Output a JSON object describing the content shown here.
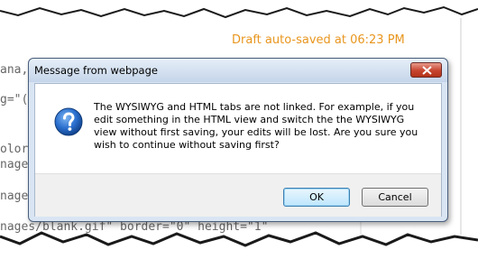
{
  "editor": {
    "autosave_text": "Draft auto-saved at 06:23 PM",
    "code_fragments": [
      "ana,",
      "g=\"(",
      "olor:",
      "nage",
      "nage",
      "nages/blank.gif\" border=\"0\" height=\"1\""
    ]
  },
  "dialog": {
    "title": "Message from webpage",
    "icon": "question-icon",
    "message": "The WYSIWYG and HTML tabs are not linked.  For example, if you edit something in the HTML view and switch the the WYSIWYG view without first saving, your edits will be lost.  Are you sure you wish to continue without saving first?",
    "ok_label": "OK",
    "cancel_label": "Cancel"
  },
  "colors": {
    "autosave": "#e8961e",
    "close_button": "#c7442f"
  }
}
